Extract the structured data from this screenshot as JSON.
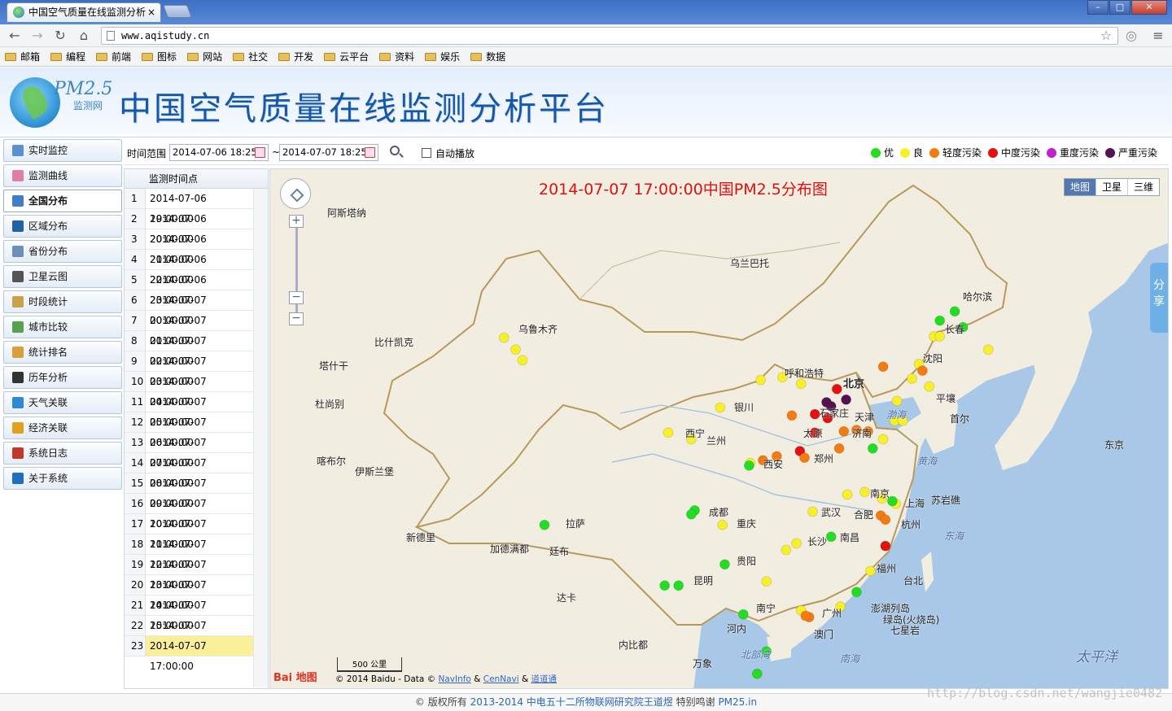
{
  "browser": {
    "tab_title": "中国空气质量在线监测分析",
    "tab_close": "×",
    "url": "www.aqistudy.cn",
    "win_min": "–",
    "win_max": "□",
    "win_close": "✕"
  },
  "bookmarks": [
    "邮箱",
    "编程",
    "前端",
    "图标",
    "网站",
    "社交",
    "开发",
    "云平台",
    "资料",
    "娱乐",
    "数据"
  ],
  "header": {
    "logo_top": "PM2.5",
    "logo_bottom": "监测网",
    "title": "中国空气质量在线监测分析平台"
  },
  "sidebar": [
    {
      "label": "实时监控",
      "color": "#5a8fd0"
    },
    {
      "label": "监测曲线",
      "color": "#e27ea3"
    },
    {
      "label": "全国分布",
      "color": "#3f7fc8"
    },
    {
      "label": "区域分布",
      "color": "#1d63a8"
    },
    {
      "label": "省份分布",
      "color": "#6c8fb5"
    },
    {
      "label": "卫星云图",
      "color": "#555"
    },
    {
      "label": "时段统计",
      "color": "#c8a347"
    },
    {
      "label": "城市比较",
      "color": "#56a24a"
    },
    {
      "label": "统计排名",
      "color": "#d9a03a"
    },
    {
      "label": "历年分析",
      "color": "#333"
    },
    {
      "label": "天气关联",
      "color": "#2e88d2"
    },
    {
      "label": "经济关联",
      "color": "#e2a11d"
    },
    {
      "label": "系统日志",
      "color": "#c0392b"
    },
    {
      "label": "关于系统",
      "color": "#1d6fc1"
    }
  ],
  "toolbar": {
    "range_label": "时间范围",
    "start": "2014-07-06 18:25",
    "sep": "~",
    "end": "2014-07-07 18:25",
    "autoplay": "自动播放"
  },
  "legend": [
    {
      "label": "优",
      "color": "#22dd22"
    },
    {
      "label": "良",
      "color": "#f7ef2a"
    },
    {
      "label": "轻度污染",
      "color": "#f47b12"
    },
    {
      "label": "中度污染",
      "color": "#e31212"
    },
    {
      "label": "重度污染",
      "color": "#c41fd1"
    },
    {
      "label": "严重污染",
      "color": "#54124f"
    }
  ],
  "table": {
    "header": "监测时间点",
    "rows": [
      "2014-07-06 19:00:00",
      "2014-07-06 20:00:00",
      "2014-07-06 21:00:00",
      "2014-07-06 22:00:00",
      "2014-07-06 23:00:00",
      "2014-07-07 00:00:00",
      "2014-07-07 01:00:00",
      "2014-07-07 02:00:00",
      "2014-07-07 03:00:00",
      "2014-07-07 04:00:00",
      "2014-07-07 05:00:00",
      "2014-07-07 06:00:00",
      "2014-07-07 07:00:00",
      "2014-07-07 08:00:00",
      "2014-07-07 09:00:00",
      "2014-07-07 10:00:00",
      "2014-07-07 11:00:00",
      "2014-07-07 12:00:00",
      "2014-07-07 13:00:00",
      "2014-07-07 14:00:00",
      "2014-07-07 15:00:00",
      "2014-07-07 16:00:00",
      "2014-07-07 17:00:00"
    ],
    "selected_index": 22
  },
  "map": {
    "title": "2014-07-07 17:00:00中国PM2.5分布图",
    "types": [
      "地图",
      "卫星",
      "三维"
    ],
    "share": "分享",
    "zoom_in": "+",
    "zoom_out": "−",
    "zoom_out2": "−",
    "scale": "500 公里",
    "baidu_logo": "Bai 地图",
    "copyright": "© 2014 Baidu - Data © ",
    "navinfo": "NavInfo",
    "amp": "&",
    "cennavi": "CenNavi",
    "amp2": "&",
    "daodao": "道道通",
    "places": [
      "阿斯塔纳",
      "乌兰巴托",
      "哈尔滨",
      "长春",
      "乌鲁木齐",
      "比什凯克",
      "塔什干",
      "沈阳",
      "呼和浩特",
      "北京",
      "平壤",
      "首尔",
      "东京",
      "杜尚别",
      "银川",
      "石家庄",
      "天津",
      "渤海",
      "太原",
      "西宁",
      "兰州",
      "济南",
      "黄海",
      "喀布尔",
      "伊斯兰堡",
      "郑州",
      "西安",
      "南京",
      "上海",
      "苏岩礁",
      "合肥",
      "武汉",
      "成都",
      "重庆",
      "长沙",
      "南昌",
      "东海",
      "拉萨",
      "新德里",
      "加德满都",
      "廷布",
      "杭州",
      "福州",
      "台北",
      "贵阳",
      "昆明",
      "达卡",
      "南宁",
      "广州",
      "澎湖列岛",
      "绿岛(火烧岛)",
      "七星岩",
      "河内",
      "澳门",
      "内比都",
      "北部湾",
      "南海",
      "太平洋",
      "万象"
    ]
  },
  "stations": [
    {
      "level": 0,
      "lon": 126.6,
      "lat": 45.8
    },
    {
      "level": 0,
      "lon": 125.3,
      "lat": 45.1
    },
    {
      "level": 0,
      "lon": 127.3,
      "lat": 44.6
    },
    {
      "level": 1,
      "lon": 124.8,
      "lat": 43.9
    },
    {
      "level": 1,
      "lon": 125.3,
      "lat": 43.9
    },
    {
      "level": 1,
      "lon": 129.5,
      "lat": 42.9
    },
    {
      "level": 1,
      "lon": 87.6,
      "lat": 43.8
    },
    {
      "level": 1,
      "lon": 88.6,
      "lat": 42.9
    },
    {
      "level": 1,
      "lon": 89.2,
      "lat": 42.1
    },
    {
      "level": 1,
      "lon": 123.5,
      "lat": 41.8
    },
    {
      "level": 1,
      "lon": 122.9,
      "lat": 40.7
    },
    {
      "level": 1,
      "lon": 121.6,
      "lat": 39.0
    },
    {
      "level": 1,
      "lon": 124.4,
      "lat": 40.1
    },
    {
      "level": 2,
      "lon": 123.8,
      "lat": 41.3
    },
    {
      "level": 2,
      "lon": 120.4,
      "lat": 41.6
    },
    {
      "level": 1,
      "lon": 111.7,
      "lat": 40.8
    },
    {
      "level": 1,
      "lon": 113.3,
      "lat": 40.3
    },
    {
      "level": 1,
      "lon": 109.8,
      "lat": 40.6
    },
    {
      "level": 3,
      "lon": 116.4,
      "lat": 39.9
    },
    {
      "level": 5,
      "lon": 115.5,
      "lat": 38.9
    },
    {
      "level": 5,
      "lon": 115.9,
      "lat": 38.6
    },
    {
      "level": 5,
      "lon": 117.2,
      "lat": 39.1
    },
    {
      "level": 3,
      "lon": 114.5,
      "lat": 38.0
    },
    {
      "level": 3,
      "lon": 115.6,
      "lat": 37.7
    },
    {
      "level": 3,
      "lon": 114.5,
      "lat": 36.6
    },
    {
      "level": 3,
      "lon": 113.2,
      "lat": 35.2
    },
    {
      "level": 2,
      "lon": 113.6,
      "lat": 34.7
    },
    {
      "level": 2,
      "lon": 112.5,
      "lat": 37.9
    },
    {
      "level": 2,
      "lon": 117.0,
      "lat": 36.7
    },
    {
      "level": 2,
      "lon": 118.1,
      "lat": 36.8
    },
    {
      "level": 2,
      "lon": 116.6,
      "lat": 35.4
    },
    {
      "level": 2,
      "lon": 119.1,
      "lat": 36.7
    },
    {
      "level": 0,
      "lon": 119.5,
      "lat": 35.4
    },
    {
      "level": 1,
      "lon": 120.4,
      "lat": 36.1
    },
    {
      "level": 1,
      "lon": 121.4,
      "lat": 37.5
    },
    {
      "level": 1,
      "lon": 122.1,
      "lat": 37.5
    },
    {
      "level": 1,
      "lon": 106.3,
      "lat": 38.5
    },
    {
      "level": 1,
      "lon": 101.8,
      "lat": 36.6
    },
    {
      "level": 1,
      "lon": 103.8,
      "lat": 36.1
    },
    {
      "level": 1,
      "lon": 108.9,
      "lat": 34.3
    },
    {
      "level": 0,
      "lon": 108.8,
      "lat": 34.1
    },
    {
      "level": 2,
      "lon": 110.0,
      "lat": 34.5
    },
    {
      "level": 2,
      "lon": 111.2,
      "lat": 34.8
    },
    {
      "level": 1,
      "lon": 118.8,
      "lat": 32.1
    },
    {
      "level": 1,
      "lon": 120.3,
      "lat": 31.6
    },
    {
      "level": 1,
      "lon": 121.5,
      "lat": 31.2
    },
    {
      "level": 0,
      "lon": 121.2,
      "lat": 31.4
    },
    {
      "level": 2,
      "lon": 120.2,
      "lat": 30.3
    },
    {
      "level": 2,
      "lon": 120.6,
      "lat": 30.0
    },
    {
      "level": 3,
      "lon": 120.6,
      "lat": 28.0
    },
    {
      "level": 1,
      "lon": 117.3,
      "lat": 31.9
    },
    {
      "level": 1,
      "lon": 114.3,
      "lat": 30.6
    },
    {
      "level": 1,
      "lon": 112.9,
      "lat": 28.2
    },
    {
      "level": 0,
      "lon": 115.9,
      "lat": 28.7
    },
    {
      "level": 1,
      "lon": 119.3,
      "lat": 26.1
    },
    {
      "level": 0,
      "lon": 118.1,
      "lat": 24.5
    },
    {
      "level": 0,
      "lon": 104.1,
      "lat": 30.7
    },
    {
      "level": 0,
      "lon": 103.8,
      "lat": 30.4
    },
    {
      "level": 1,
      "lon": 106.5,
      "lat": 29.6
    },
    {
      "level": 0,
      "lon": 106.7,
      "lat": 26.6
    },
    {
      "level": 0,
      "lon": 102.7,
      "lat": 25.0
    },
    {
      "level": 0,
      "lon": 101.5,
      "lat": 25.0
    },
    {
      "level": 0,
      "lon": 108.3,
      "lat": 22.8
    },
    {
      "level": 1,
      "lon": 113.3,
      "lat": 23.1
    },
    {
      "level": 2,
      "lon": 114.0,
      "lat": 22.6
    },
    {
      "level": 2,
      "lon": 113.7,
      "lat": 22.7
    },
    {
      "level": 0,
      "lon": 110.3,
      "lat": 20.0
    },
    {
      "level": 0,
      "lon": 109.5,
      "lat": 18.3
    },
    {
      "level": 0,
      "lon": 91.1,
      "lat": 29.6
    },
    {
      "level": 1,
      "lon": 112.0,
      "lat": 27.7
    },
    {
      "level": 1,
      "lon": 110.3,
      "lat": 25.3
    },
    {
      "level": 1,
      "lon": 116.7,
      "lat": 23.4
    }
  ]
}
